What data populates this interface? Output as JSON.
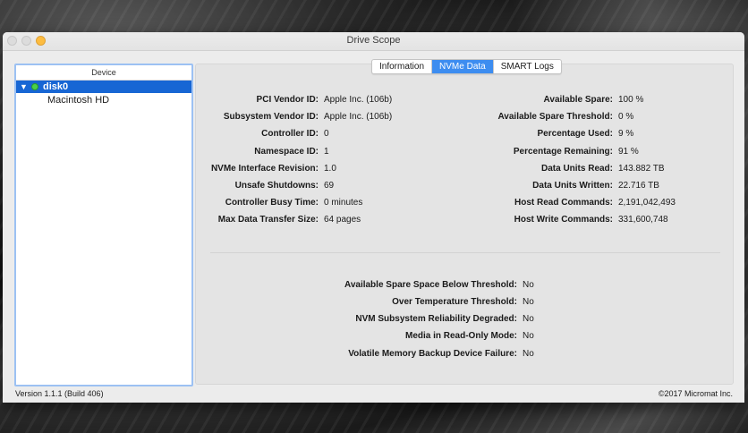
{
  "window": {
    "title": "Drive Scope"
  },
  "sidebar": {
    "header": "Device",
    "disk": {
      "label": "disk0",
      "status_color": "#4ad04a"
    },
    "volume": "Macintosh HD"
  },
  "tabs": [
    {
      "label": "Information",
      "active": false
    },
    {
      "label": "NVMe Data",
      "active": true
    },
    {
      "label": "SMART Logs",
      "active": false
    }
  ],
  "nvme_left": [
    {
      "key": "PCI Vendor ID:",
      "value": "Apple Inc. (106b)"
    },
    {
      "key": "Subsystem Vendor ID:",
      "value": "Apple Inc. (106b)"
    },
    {
      "key": "Controller ID:",
      "value": "0"
    },
    {
      "key": "Namespace ID:",
      "value": "1"
    },
    {
      "key": "NVMe Interface Revision:",
      "value": "1.0"
    },
    {
      "key": "Unsafe Shutdowns:",
      "value": "69"
    },
    {
      "key": "Controller Busy Time:",
      "value": "0 minutes"
    },
    {
      "key": "Max Data Transfer Size:",
      "value": "64 pages"
    }
  ],
  "nvme_right": [
    {
      "key": "Available Spare:",
      "value": "100 %"
    },
    {
      "key": "Available Spare Threshold:",
      "value": "0 %"
    },
    {
      "key": "Percentage Used:",
      "value": "9 %"
    },
    {
      "key": "Percentage Remaining:",
      "value": "91 %"
    },
    {
      "key": "Data Units Read:",
      "value": "143.882 TB"
    },
    {
      "key": "Data Units Written:",
      "value": "22.716 TB"
    },
    {
      "key": "Host Read Commands:",
      "value": "2,191,042,493"
    },
    {
      "key": "Host Write Commands:",
      "value": "331,600,748"
    }
  ],
  "warnings": [
    {
      "key": "Available Spare Space Below Threshold:",
      "value": "No"
    },
    {
      "key": "Over Temperature Threshold:",
      "value": "No"
    },
    {
      "key": "NVM Subsystem Reliability Degraded:",
      "value": "No"
    },
    {
      "key": "Media in Read-Only Mode:",
      "value": "No"
    },
    {
      "key": "Volatile Memory Backup Device Failure:",
      "value": "No"
    }
  ],
  "footer": {
    "version": "Version 1.1.1 (Build 406)",
    "copyright": "©2017 Micromat Inc."
  },
  "colors": {
    "accent": "#1766d4",
    "tab_active": "#3d8df0",
    "zoom_button": "#fdbc40"
  }
}
